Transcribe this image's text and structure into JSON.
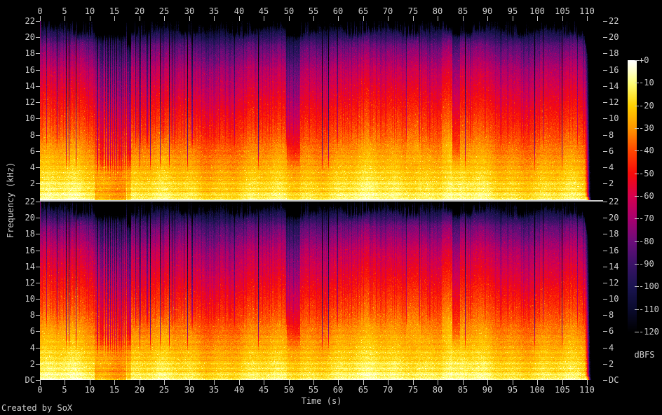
{
  "window": {
    "background": "#000000"
  },
  "footer": {
    "credit": "Created by SoX"
  },
  "chart_data": {
    "type": "heatmap",
    "subtype": "stereo-audio-spectrogram",
    "channels": 2,
    "xlabel": "Time (s)",
    "ylabel": "Frequency (kHz)",
    "x_ticks_s": [
      0,
      5,
      10,
      15,
      20,
      25,
      30,
      35,
      40,
      45,
      50,
      55,
      60,
      65,
      70,
      75,
      80,
      85,
      90,
      95,
      100,
      105,
      110
    ],
    "x_range_s": [
      0,
      113.2
    ],
    "y_freq_ticks_khz": [
      22,
      20,
      18,
      16,
      14,
      12,
      10,
      8,
      6,
      4,
      2
    ],
    "dc_label": "DC",
    "y_range_khz": [
      0,
      22
    ],
    "text_color": "#cfcfcf",
    "axis_color": "#c8c8c8",
    "separator_color": "#cacaca",
    "colorbar": {
      "label": "dBFS",
      "ticks": [
        "+0",
        "-10",
        "-20",
        "-30",
        "-40",
        "-50",
        "-60",
        "-70",
        "-80",
        "-90",
        "-100",
        "-110",
        "-120"
      ],
      "range_db": [
        0,
        -120
      ],
      "colormap": [
        {
          "pos": 0.0,
          "color": "#000000"
        },
        {
          "pos": 0.083,
          "color": "#0a0a2d"
        },
        {
          "pos": 0.167,
          "color": "#1a1450"
        },
        {
          "pos": 0.25,
          "color": "#3a1268"
        },
        {
          "pos": 0.333,
          "color": "#6b0d7a"
        },
        {
          "pos": 0.417,
          "color": "#a8006e"
        },
        {
          "pos": 0.5,
          "color": "#d5004e"
        },
        {
          "pos": 0.583,
          "color": "#f60a0a"
        },
        {
          "pos": 0.667,
          "color": "#ff4600"
        },
        {
          "pos": 0.75,
          "color": "#ff9600"
        },
        {
          "pos": 0.833,
          "color": "#ffd000"
        },
        {
          "pos": 0.917,
          "color": "#ffff78"
        },
        {
          "pos": 0.96,
          "color": "#ffffc8"
        },
        {
          "pos": 1.0,
          "color": "#ffffff"
        }
      ]
    },
    "events": {
      "striped_section_s": [
        11,
        17.3
      ],
      "silence_gap_s": [
        17.35,
        18.25
      ],
      "quiet_bands_s": [
        [
          49.6,
          52.2
        ],
        [
          82.9,
          84.4
        ]
      ],
      "bright_moments_s": [
        [
          73.5,
          76.5
        ],
        [
          80.8,
          82.9
        ]
      ],
      "audio_end_s": 110.3,
      "spectrum_top_khz": 20.5
    }
  }
}
